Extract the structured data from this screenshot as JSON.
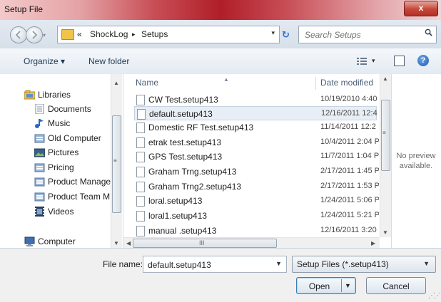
{
  "window": {
    "title": "Setup File",
    "close_label": "x"
  },
  "address": {
    "overflow": "«",
    "crumbs": [
      "ShockLog",
      "Setups"
    ],
    "separator": "▸",
    "dropdown_glyph": "▾",
    "refresh_glyph": "↻",
    "nav_dropdown_glyph": "▾"
  },
  "search": {
    "placeholder": "Search Setups"
  },
  "toolbar": {
    "organize_label": "Organize ▾",
    "new_folder_label": "New folder",
    "view_dropdown_glyph": "▾",
    "help_glyph": "?"
  },
  "nav": {
    "items": [
      {
        "label": "Libraries",
        "icon": "libraries-icon"
      },
      {
        "label": "Documents",
        "icon": "documents-icon"
      },
      {
        "label": "Music",
        "icon": "music-icon"
      },
      {
        "label": "Old Computer",
        "icon": "library-icon"
      },
      {
        "label": "Pictures",
        "icon": "pictures-icon"
      },
      {
        "label": "Pricing",
        "icon": "library-icon"
      },
      {
        "label": "Product Manage",
        "icon": "library-icon"
      },
      {
        "label": "Product Team M",
        "icon": "library-icon"
      },
      {
        "label": "Videos",
        "icon": "videos-icon"
      },
      {
        "label": "Computer",
        "icon": "computer-icon"
      }
    ]
  },
  "files": {
    "columns": {
      "name": "Name",
      "date": "Date modified"
    },
    "sort_indicator": "▲",
    "rows": [
      {
        "name": "CW Test.setup413",
        "date": "10/19/2010 4:40",
        "selected": false
      },
      {
        "name": "default.setup413",
        "date": "12/16/2011 12:4",
        "selected": true
      },
      {
        "name": "Domestic RF Test.setup413",
        "date": "11/14/2011 12:2",
        "selected": false
      },
      {
        "name": "etrak test.setup413",
        "date": "10/4/2011 2:04 P",
        "selected": false
      },
      {
        "name": "GPS Test.setup413",
        "date": "11/7/2011 1:04 P",
        "selected": false
      },
      {
        "name": "Graham Trng.setup413",
        "date": "2/17/2011 1:45 P",
        "selected": false
      },
      {
        "name": "Graham Trng2.setup413",
        "date": "2/17/2011 1:53 P",
        "selected": false
      },
      {
        "name": "loral.setup413",
        "date": "1/24/2011 5:06 P",
        "selected": false
      },
      {
        "name": "loral1.setup413",
        "date": "1/24/2011 5:21 P",
        "selected": false
      },
      {
        "name": "manual .setup413",
        "date": "12/16/2011 3:20",
        "selected": false
      }
    ],
    "hscroll_grip": "III"
  },
  "preview": {
    "line1": "No preview",
    "line2": "available."
  },
  "footer": {
    "file_name_label": "File name:",
    "file_name_value": "default.setup413",
    "filter_label": "Setup Files (*.setup413)",
    "open_label": "Open",
    "cancel_label": "Cancel"
  },
  "colors": {
    "title_red": "#b01e29",
    "selection": "#e8eef5",
    "accent_blue": "#1e5ab8"
  }
}
